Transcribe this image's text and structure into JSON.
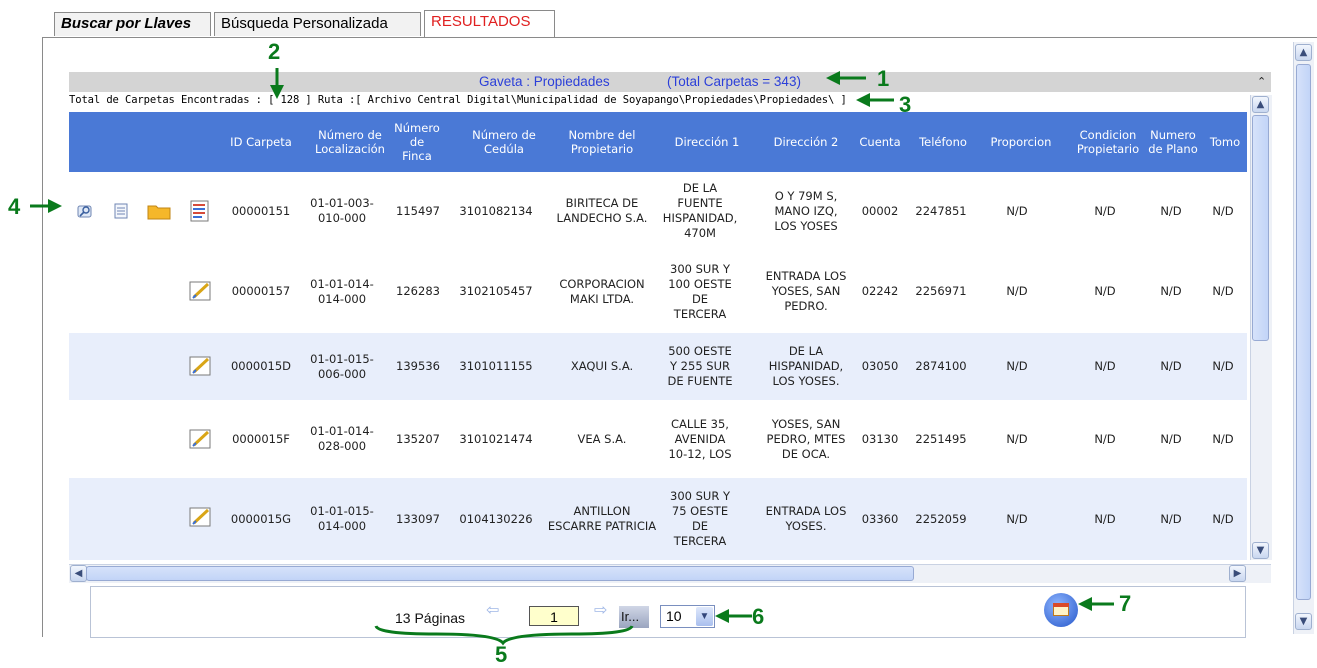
{
  "tabs": [
    "Buscar por Llaves",
    "Búsqueda Personalizada",
    "RESULTADOS"
  ],
  "gaveta": {
    "label": "Gaveta : Propiedades",
    "total": "(Total Carpetas = 343)",
    "collapse_icon": "double-chevron-up-icon"
  },
  "ruta": "Total de Carpetas Encontradas : [ 128 ] Ruta :[ Archivo Central Digital\\Municipalidad de Soyapango\\Propiedades\\Propiedades\\ ]",
  "columns": [
    "ID Carpeta",
    "Número de Localización",
    "Número de Finca",
    "Número de Cedúla",
    "Nombre del Propietario",
    "Dirección 1",
    "Dirección 2",
    "Cuenta",
    "Teléfono",
    "Proporcion",
    "Condicion Propietario",
    "Numero de Plano",
    "Tomo"
  ],
  "rows": [
    {
      "id": "00000151",
      "loc": "01-01-003-010-000",
      "finca": "115497",
      "cedula": "3101082134",
      "nombre": "BIRITECA DE LANDECHO S.A.",
      "dir1": "DE LA FUENTE HISPANIDAD, 470M",
      "dir2": "O Y 79M S, MANO IZQ, LOS YOSES",
      "cuenta": "00002",
      "telefono": "2247851",
      "proporcion": "N/D",
      "condicion": "N/D",
      "plano": "N/D",
      "tomo": "N/D"
    },
    {
      "id": "00000157",
      "loc": "01-01-014-014-000",
      "finca": "126283",
      "cedula": "3102105457",
      "nombre": "CORPORACION MAKI LTDA.",
      "dir1": "300 SUR Y 100 OESTE DE TERCERA",
      "dir2": "ENTRADA LOS YOSES, SAN PEDRO.",
      "cuenta": "02242",
      "telefono": "2256971",
      "proporcion": "N/D",
      "condicion": "N/D",
      "plano": "N/D",
      "tomo": "N/D"
    },
    {
      "id": "0000015D",
      "loc": "01-01-015-006-000",
      "finca": "139536",
      "cedula": "3101011155",
      "nombre": "XAQUI S.A.",
      "dir1": "500 OESTE Y 255 SUR DE FUENTE",
      "dir2": "DE LA HISPANIDAD, LOS YOSES.",
      "cuenta": "03050",
      "telefono": "2874100",
      "proporcion": "N/D",
      "condicion": "N/D",
      "plano": "N/D",
      "tomo": "N/D"
    },
    {
      "id": "0000015F",
      "loc": "01-01-014-028-000",
      "finca": "135207",
      "cedula": "3101021474",
      "nombre": "VEA S.A.",
      "dir1": "CALLE 35, AVENIDA 10-12, LOS",
      "dir2": "YOSES, SAN PEDRO, MTES DE OCA.",
      "cuenta": "03130",
      "telefono": "2251495",
      "proporcion": "N/D",
      "condicion": "N/D",
      "plano": "N/D",
      "tomo": "N/D"
    },
    {
      "id": "0000015G",
      "loc": "01-01-015-014-000",
      "finca": "133097",
      "cedula": "0104130226",
      "nombre": "ANTILLON ESCARRE PATRICIA",
      "dir1": "300 SUR Y 75 OESTE DE TERCERA",
      "dir2": "ENTRADA LOS YOSES.",
      "cuenta": "03360",
      "telefono": "2252059",
      "proporcion": "N/D",
      "condicion": "N/D",
      "plano": "N/D",
      "tomo": "N/D"
    }
  ],
  "pager": {
    "pages_label": "13 Páginas",
    "page": "1",
    "go_label": "Ir...",
    "page_size": "10",
    "prev_icon": "arrow-left-icon",
    "next_icon": "arrow-right-icon"
  },
  "annotations": [
    "1",
    "2",
    "3",
    "4",
    "5",
    "6",
    "7"
  ],
  "colors": {
    "header": "#4a79d6",
    "alt_row": "#e8eefb",
    "annotation": "#0a7a1c",
    "tab_active": "#e02020",
    "gaveta_text": "#2b3fd9"
  }
}
